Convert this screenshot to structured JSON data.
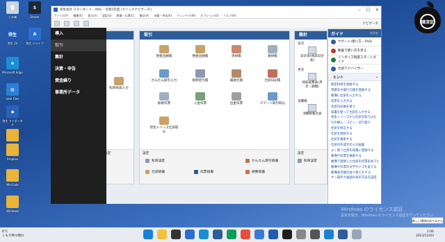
{
  "desktop": {
    "icons": [
      {
        "label": "ごみ箱",
        "color": "#c9d6e8",
        "glyph": "🗑"
      },
      {
        "label": "Steam",
        "color": "#1b2838",
        "glyph": "S"
      },
      {
        "label": "弥生 24",
        "color": "#1e5bb5",
        "glyph": "弥生"
      },
      {
        "label": "弥生 ドライブ",
        "color": "#2b6fce",
        "glyph": "A"
      },
      {
        "label": "Microsoft Edge",
        "color": "#1a8fd6",
        "glyph": "e"
      },
      {
        "label": "Intel Files",
        "color": "#2c7fd6",
        "glyph": "▤"
      },
      {
        "label": "弥生 マイポータル",
        "color": "#2a62b8",
        "glyph": "◆"
      },
      {
        "label": "",
        "color": "#e8b43a",
        "glyph": ""
      },
      {
        "label": "Dropbox",
        "color": "#e8b43a",
        "glyph": ""
      },
      {
        "label": "WinCode",
        "color": "#e8b43a",
        "glyph": ""
      },
      {
        "label": "Windows",
        "color": "#e8b43a",
        "glyph": ""
      }
    ],
    "logo_text": "確済定"
  },
  "window": {
    "title": "弥生会計 スタンダード - MAC - 令和5年度 [クイックナビゲータ]",
    "menus": [
      "ファイル(F)",
      "編集(E)",
      "表示(V)",
      "設定(S)",
      "帳簿・伝票(C)",
      "集計(A)",
      "決算・申告(K)",
      "ウィンドウ(W)",
      "オプション(O)",
      "ヘルプ(H)"
    ],
    "nav_button": "ナビゲータ"
  },
  "left_menu": {
    "items": [
      "導入",
      "取引",
      "集計",
      "決算・申告",
      "資金繰り",
      "事業所データ"
    ]
  },
  "torihiki": {
    "heading": "取引",
    "tiles": [
      {
        "label": "現金出納帳",
        "color": "#c9a26a"
      },
      {
        "label": "預金出納帳",
        "color": "#c9a26a"
      },
      {
        "label": "売掛帳",
        "color": "#c98a6a"
      },
      {
        "label": "買掛帳",
        "color": "#a0b0c0"
      },
      {
        "label": "かんたん取引入力",
        "color": "#6a9ac9"
      },
      {
        "label": "総勘定元帳",
        "color": "#8a9ab0"
      },
      {
        "label": "補助元帳",
        "color": "#b08a6a"
      },
      {
        "label": "仕訳日記帳",
        "color": "#c07060"
      },
      {
        "label": "振替伝票",
        "color": "#a0b0c0"
      },
      {
        "label": "入金伝票",
        "color": "#7aa07a"
      },
      {
        "label": "出金伝票",
        "color": "#a0a0a0"
      },
      {
        "label": "スマート取引取込",
        "color": "#6a9ac9"
      },
      {
        "label": "弥生シリーズ仕訳取込",
        "color": "#c9a26a"
      }
    ],
    "settings_label": "設定",
    "settings_links": [
      {
        "label": "科目設定",
        "color": "#8a9ab0"
      },
      {
        "label": "かんたん取引辞書",
        "color": "#c97050"
      },
      {
        "label": "仕訳辞書",
        "color": "#c9a26a"
      },
      {
        "label": "伝票辞書",
        "color": "#2f5d9a"
      },
      {
        "label": "摘要辞書",
        "color": "#c97050"
      }
    ]
  },
  "left_panel": {
    "partial_label": "科目残高入力",
    "settings_label": "設定",
    "settings_link": "設定"
  },
  "shuukei": {
    "heading": "集計",
    "section_daily": "日次",
    "daily_items": [
      "日計表(残高日計表)"
    ],
    "section_monthly": "月次",
    "monthly_items": [
      "残高試算表(月次・期間)"
    ],
    "section_tax": "消費税",
    "tax_items": [
      "消費税集計表"
    ],
    "settings_label": "設定",
    "settings_link": "科目設定"
  },
  "guide": {
    "title": "ガイド",
    "close_label": "たたむ",
    "rows": [
      "サポート(使い方・FAQ)",
      "動画で使い方を見る",
      "インボイス制度スタートガイド",
      "仕訳アドバイザー"
    ],
    "hint_title": "ヒント",
    "hints": [
      "勘定科目を登録する",
      "得意先や銀行口座を登録する",
      "帳簿に仕訳を入力する",
      "伝票を入力する",
      "仕訳日記帳を使う",
      "辞書を使って仕訳を入力する",
      "弥生シリーズから仕訳を取り込む",
      "行の挿入・コピー・切り取り",
      "仕訳を修正する",
      "仕訳を削除する",
      "仕訳を検索する",
      "仕訳の作成元の入力画面",
      "よく使う仕訳を辞書に登録する",
      "帳簿や伝票を検索する",
      "帳簿で登録した仕訳を伝票形式で表示する",
      "帳簿や伝票の文字サイズを変える",
      "帳簿表示順の並べ替えをする",
      "キー操作や画面の表示方法を設定"
    ]
  },
  "watermark": {
    "line1": "Windows のライセンス認証",
    "line2": "設定を開き、Windows のライセンス認証を行ってください"
  },
  "notification": "新しい通知はありません",
  "taskbar": {
    "weather_temp": "6°C",
    "weather_desc": "くもり時々晴れ",
    "time": "1:06",
    "date": "2023/12/03",
    "apps": [
      "#1a7fd6",
      "#f3c23a",
      "#333333",
      "#2b6fce",
      "#1a8fd6",
      "#2f5d9a",
      "#0f9d58",
      "#e94e3c",
      "#3a7ad6",
      "#1e5bb5",
      "#1f1f1f",
      "#888888",
      "#555555",
      "#1a7fd6",
      "#2f5d9a",
      "#9aa5b5"
    ]
  }
}
